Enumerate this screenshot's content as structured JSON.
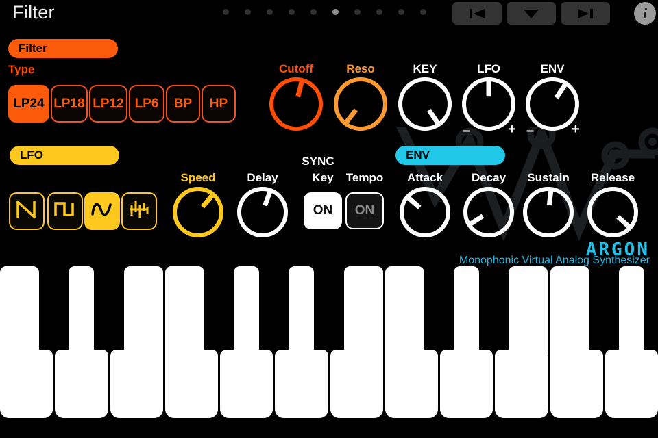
{
  "topbar": {
    "title": "Filter",
    "dots": {
      "count": 10,
      "active_index": 5
    },
    "buttons": [
      {
        "name": "prev-preset-button",
        "icon": "skip-previous-icon",
        "label": ""
      },
      {
        "name": "preset-list-button",
        "icon": "chevron-down-icon",
        "label": ""
      },
      {
        "name": "next-preset-button",
        "icon": "skip-next-icon",
        "label": ""
      }
    ],
    "info_label": "i"
  },
  "filter_section": {
    "pill_label": "Filter",
    "accent": "#FA5A0A",
    "type_label": "Type",
    "types": [
      {
        "label": "LP24",
        "selected": true
      },
      {
        "label": "LP18",
        "selected": false
      },
      {
        "label": "LP12",
        "selected": false
      },
      {
        "label": "LP6",
        "selected": false
      },
      {
        "label": "BP",
        "selected": false
      },
      {
        "label": "HP",
        "selected": false
      }
    ],
    "knobs": [
      {
        "label": "Cutoff",
        "color": "#FF4D06",
        "angle": 14,
        "bipolar": false
      },
      {
        "label": "Reso",
        "color": "#FF9A33",
        "angle": 218,
        "bipolar": false
      },
      {
        "label": "KEY",
        "color": "#FFFFFF",
        "angle": 146,
        "bipolar": false
      },
      {
        "label": "LFO",
        "color": "#FFFFFF",
        "angle": 0,
        "bipolar": true
      },
      {
        "label": "ENV",
        "color": "#FFFFFF",
        "angle": 33,
        "bipolar": true
      }
    ],
    "bipolar_minus": "–",
    "bipolar_plus": "+"
  },
  "lfo_section": {
    "pill_label": "LFO",
    "accent": "#FFC81E",
    "waveforms": [
      {
        "name": "sawtooth-wave-icon",
        "selected": false
      },
      {
        "name": "square-wave-icon",
        "selected": false
      },
      {
        "name": "sine-wave-icon",
        "selected": true
      },
      {
        "name": "random-wave-icon",
        "selected": false
      }
    ],
    "knobs": [
      {
        "label": "Speed",
        "color": "#FFC81E",
        "angle": 40
      },
      {
        "label": "Delay",
        "color": "#FFFFFF",
        "angle": 20
      }
    ],
    "sync": {
      "group_label": "SYNC",
      "toggles": [
        {
          "label": "Key",
          "value": "ON",
          "active": true
        },
        {
          "label": "Tempo",
          "value": "ON",
          "active": false
        }
      ]
    }
  },
  "env_section": {
    "pill_label": "ENV",
    "accent": "#22C8E8",
    "knobs": [
      {
        "label": "Attack",
        "color": "#FFFFFF",
        "angle": 311
      },
      {
        "label": "Decay",
        "color": "#FFFFFF",
        "angle": 237
      },
      {
        "label": "Sustain",
        "color": "#FFFFFF",
        "angle": 7
      },
      {
        "label": "Release",
        "color": "#FFFFFF",
        "angle": 132
      }
    ]
  },
  "branding": {
    "name": "ARGON",
    "tagline": "Monophonic Virtual Analog Synthesizer",
    "color": "#22C0E8"
  },
  "keyboard": {
    "white_key_count": 12,
    "pattern": "C D E F G A B"
  }
}
